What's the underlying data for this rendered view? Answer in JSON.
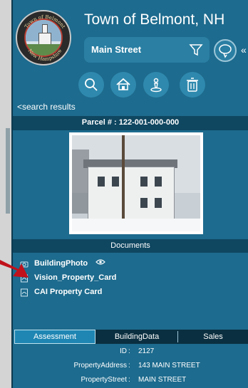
{
  "app": {
    "title": "Town of Belmont, NH",
    "seal_text_top": "Town of Belmont",
    "seal_text_bottom": "New Hampshire"
  },
  "search": {
    "value": "Main Street"
  },
  "toolbar": {
    "icons": [
      "search-icon",
      "home-icon",
      "person-location-icon",
      "trash-icon"
    ]
  },
  "nav": {
    "back_label": "<search results"
  },
  "parcel": {
    "label": "Parcel # : 122-001-000-000"
  },
  "documents": {
    "header": "Documents",
    "links": [
      {
        "label": "BuildingPhoto",
        "icon": "camera-icon"
      },
      {
        "label": "Vision_Property_Card",
        "icon": "pdf-icon"
      },
      {
        "label": "CAI Property Card",
        "icon": "pdf-icon"
      }
    ]
  },
  "tabs": [
    {
      "label": "Assessment",
      "active": true
    },
    {
      "label": "BuildingData",
      "active": false
    },
    {
      "label": "Sales",
      "active": false
    }
  ],
  "details": [
    {
      "key": "ID",
      "value": "2127"
    },
    {
      "key": "PropertyAddress",
      "value": "143 MAIN STREET"
    },
    {
      "key": "PropertyStreet",
      "value": "MAIN STREET"
    }
  ],
  "colors": {
    "panel": "#1d6b8e",
    "header_bar": "#0f4660",
    "active_tab": "#1f86b3",
    "arrow": "#c0121b"
  }
}
